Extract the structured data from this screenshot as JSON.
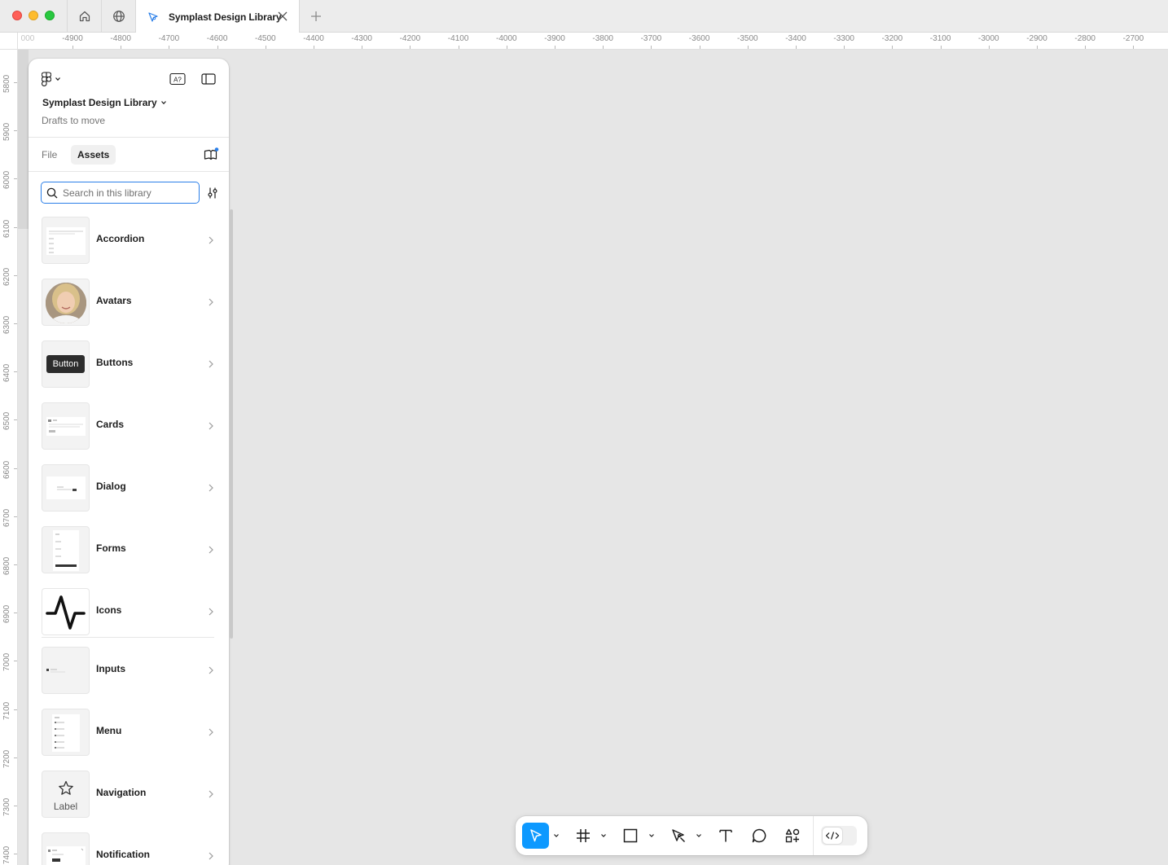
{
  "window": {
    "tab_title": "Symplast Design Library"
  },
  "ruler": {
    "top_labels": [
      "-4900",
      "-4800",
      "-4700",
      "-4600",
      "-4500",
      "-4400",
      "-4300",
      "-4200",
      "-4100",
      "-4000",
      "-3900",
      "-3800",
      "-3700",
      "-3600",
      "-3500",
      "-3400",
      "-3300",
      "-3200",
      "-3100",
      "-3000",
      "-2900",
      "-2800",
      "-2700"
    ],
    "left_labels": [
      "5800",
      "5900",
      "6000",
      "6100",
      "6200",
      "6300",
      "6400",
      "6500",
      "6600",
      "6700",
      "6800",
      "6900",
      "7000",
      "7100",
      "7200",
      "7300",
      "7400"
    ],
    "partial_label": "000"
  },
  "panel": {
    "file_title": "Symplast Design Library",
    "subtitle": "Drafts to move",
    "tabs": {
      "file": "File",
      "assets": "Assets"
    },
    "search": {
      "placeholder": "Search in this library"
    },
    "libraries": [
      {
        "label": "Accordion"
      },
      {
        "label": "Avatars"
      },
      {
        "label": "Buttons",
        "thumb_text": "Button"
      },
      {
        "label": "Cards"
      },
      {
        "label": "Dialog"
      },
      {
        "label": "Forms"
      },
      {
        "label": "Icons"
      },
      {
        "label": "Inputs"
      },
      {
        "label": "Menu"
      },
      {
        "label": "Navigation",
        "thumb_text": "Label"
      },
      {
        "label": "Notification"
      }
    ]
  },
  "toolbar": {
    "tools": [
      "move-tool",
      "frame-tool",
      "shape-tool",
      "pen-tool",
      "text-tool",
      "comment-tool",
      "actions-tool"
    ],
    "dev_mode": "off"
  },
  "colors": {
    "accent": "#0d99ff",
    "focus": "#2b7fe8",
    "canvas": "#e6e6e6"
  }
}
